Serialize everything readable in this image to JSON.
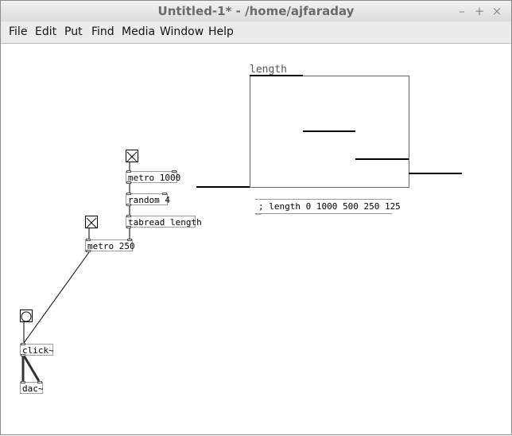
{
  "window": {
    "title": "Untitled-1* - /home/ajfaraday",
    "minimize": "–",
    "maximize": "+",
    "close": "×"
  },
  "menubar": {
    "items": [
      "File",
      "Edit",
      "Put",
      "Find",
      "Media",
      "Window",
      "Help"
    ]
  },
  "patch": {
    "objects": {
      "metro_1000": "metro 1000",
      "random_4": "random 4",
      "tabread": "tabread length",
      "metro_250": "metro 250",
      "click": "click~",
      "dac": "dac~"
    },
    "message": "; length 0 1000 500 250 125",
    "array": {
      "name": "length",
      "values": [
        0,
        1000,
        500,
        250,
        125
      ],
      "yrange": [
        1000,
        0
      ]
    }
  }
}
